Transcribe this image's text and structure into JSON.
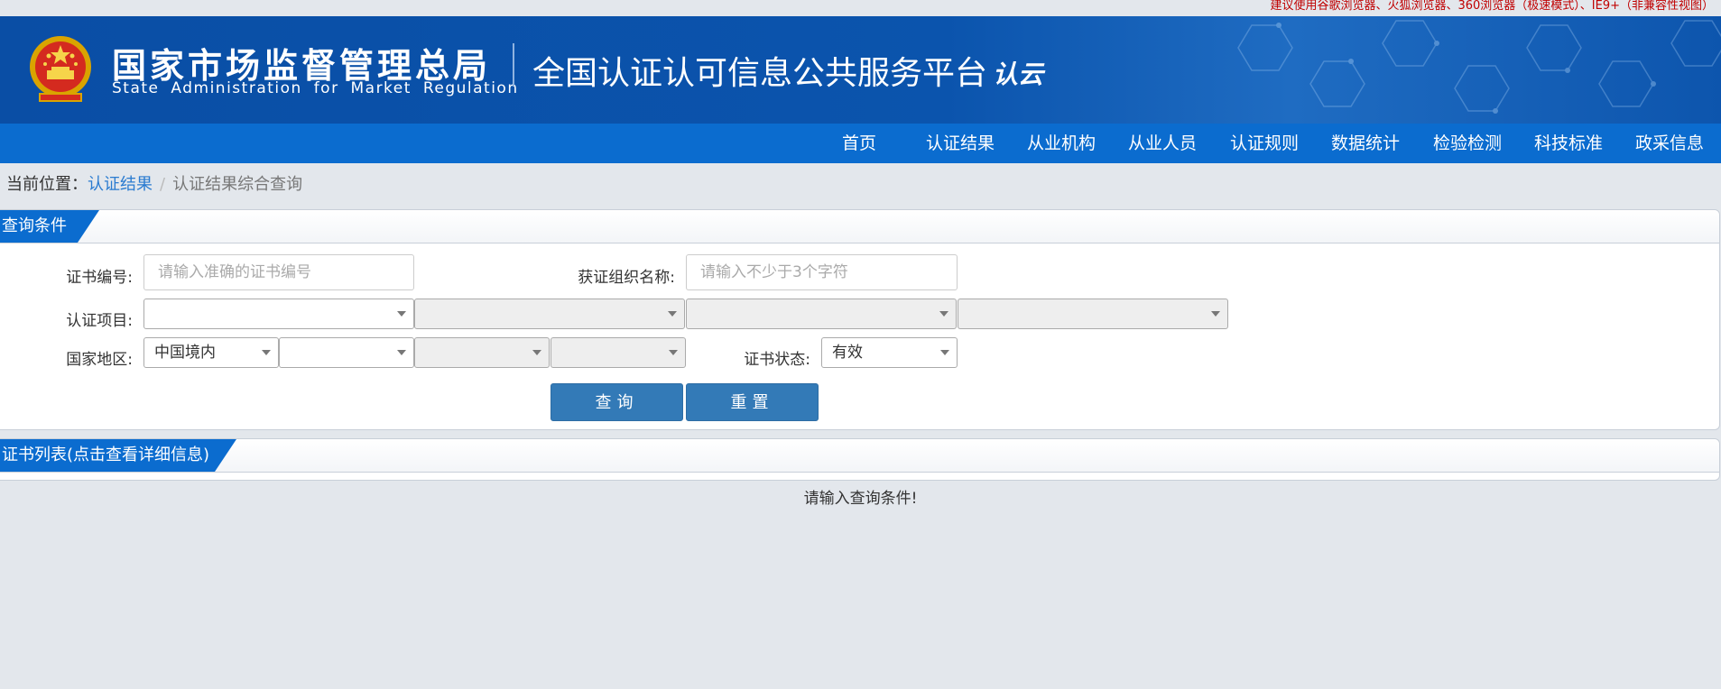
{
  "topbar": {
    "browser_notice": "建议使用谷歌浏览器、火狐浏览器、360浏览器（极速模式）、IE9+（非兼容性视图）"
  },
  "header": {
    "org_name_cn": "国家市场监督管理总局",
    "org_name_en": "State Administration for Market Regulation",
    "platform_name": "全国认证认可信息公共服务平台",
    "brand_logo": "认云"
  },
  "nav": {
    "items": [
      {
        "label": "首页"
      },
      {
        "label": "认证结果"
      },
      {
        "label": "从业机构"
      },
      {
        "label": "从业人员"
      },
      {
        "label": "认证规则"
      },
      {
        "label": "数据统计"
      },
      {
        "label": "检验检测"
      },
      {
        "label": "科技标准"
      },
      {
        "label": "政采信息"
      }
    ]
  },
  "breadcrumb": {
    "prefix": "当前位置：",
    "link": "认证结果",
    "separator": "/",
    "current": "认证结果综合查询"
  },
  "query_panel": {
    "title": "查询条件",
    "cert_no_label": "证书编号:",
    "cert_no_placeholder": "请输入准确的证书编号",
    "org_name_label": "获证组织名称:",
    "org_name_placeholder": "请输入不少于3个字符",
    "cert_project_label": "认证项目:",
    "region_label": "国家地区:",
    "region_value": "中国境内",
    "cert_status_label": "证书状态:",
    "cert_status_value": "有效",
    "search_button": "查询",
    "reset_button": "重置"
  },
  "results_panel": {
    "title": "证书列表(点击查看详细信息)",
    "empty_message": "请输入查询条件!"
  },
  "colors": {
    "header_blue": "#0a4ea5",
    "nav_blue": "#0b6ccf",
    "button_blue": "#337ab7",
    "notice_red": "#c00000",
    "link_blue": "#2a7bd0"
  }
}
